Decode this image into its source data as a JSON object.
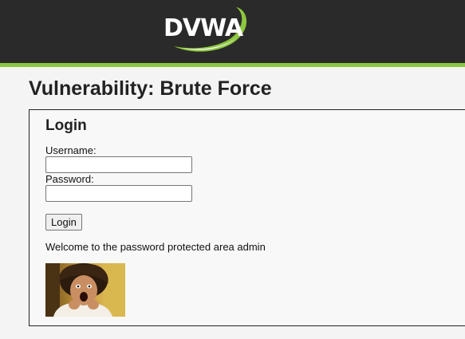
{
  "header": {
    "logo_text": "DVWA"
  },
  "page": {
    "title": "Vulnerability: Brute Force"
  },
  "login": {
    "heading": "Login",
    "username_label": "Username:",
    "username_value": "",
    "password_label": "Password:",
    "password_value": "",
    "button_label": "Login",
    "welcome_message": "Welcome to the password protected area admin"
  },
  "colors": {
    "header_bg": "#2a2a2a",
    "accent": "#8dc63f",
    "page_bg": "#f4f4f4"
  },
  "icons": {
    "logo": "dvwa-logo-swoosh",
    "avatar": "user-photo"
  }
}
